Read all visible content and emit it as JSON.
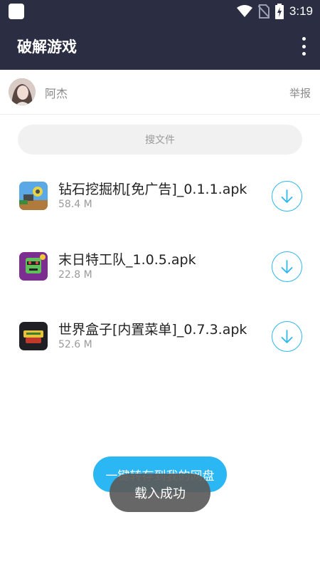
{
  "status_bar": {
    "time": "3:19",
    "icons": [
      "app-notification-icon",
      "wifi-icon",
      "no-sim-icon",
      "battery-charging-icon"
    ]
  },
  "app_bar": {
    "title": "破解游戏",
    "menu_icon": "more-vert-icon"
  },
  "user": {
    "name": "阿杰",
    "report_label": "举报"
  },
  "search": {
    "placeholder": "搜文件"
  },
  "files": [
    {
      "name": "钻石挖掘机[免广告]_0.1.1.apk",
      "size": "58.4 M",
      "icon": "digger-game-icon"
    },
    {
      "name": "末日特工队_1.0.5.apk",
      "size": "22.8 M",
      "icon": "zombie-agent-game-icon"
    },
    {
      "name": "世界盒子[内置菜单]_0.7.3.apk",
      "size": "52.6 M",
      "icon": "worldbox-game-icon"
    }
  ],
  "actions": {
    "save_all_label": "一键转存到我的网盘"
  },
  "toast": {
    "message": "载入成功"
  },
  "colors": {
    "header_bg": "#2b2e42",
    "accent": "#2ab7f3",
    "toast_bg": "#5a5a5a"
  }
}
